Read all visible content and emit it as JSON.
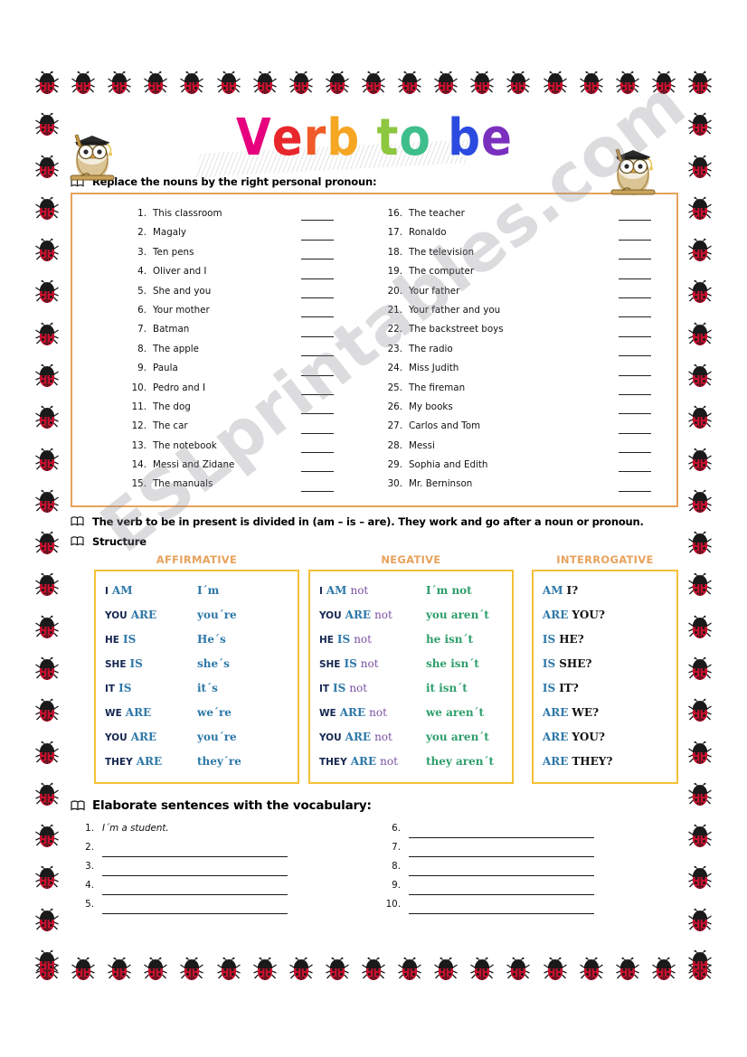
{
  "title": {
    "letters": [
      {
        "ch": "V",
        "color": "#E6007E"
      },
      {
        "ch": "e",
        "color": "#E8272C"
      },
      {
        "ch": "r",
        "color": "#F05A28"
      },
      {
        "ch": "b",
        "color": "#F5A623"
      },
      {
        "ch": " ",
        "color": "#ffffff"
      },
      {
        "ch": "t",
        "color": "#8DC63F"
      },
      {
        "ch": "o",
        "color": "#3DBE8B"
      },
      {
        "ch": " ",
        "color": "#ffffff"
      },
      {
        "ch": "b",
        "color": "#2B4BE0"
      },
      {
        "ch": "e",
        "color": "#7B2FBE"
      }
    ],
    "plain": "Verb to be"
  },
  "instructions": {
    "replace_nouns": "Replace the nouns by the right personal pronoun:",
    "verb_explain": "The verb to be in present is divided in (am – is – are). They work and go after a noun or pronoun.",
    "structure": "Structure",
    "elaborate": "Elaborate sentences with the vocabulary:"
  },
  "nouns_exercise": {
    "blank_placeholder": "",
    "column_left": [
      {
        "num": "1.",
        "text": "This classroom"
      },
      {
        "num": "2.",
        "text": "Magaly"
      },
      {
        "num": "3.",
        "text": "Ten pens"
      },
      {
        "num": "4.",
        "text": "Oliver and I"
      },
      {
        "num": "5.",
        "text": "She and you"
      },
      {
        "num": "6.",
        "text": "Your mother"
      },
      {
        "num": "7.",
        "text": "Batman"
      },
      {
        "num": "8.",
        "text": "The apple"
      },
      {
        "num": "9.",
        "text": "Paula"
      },
      {
        "num": "10.",
        "text": "Pedro and I"
      },
      {
        "num": "11.",
        "text": "The dog"
      },
      {
        "num": "12.",
        "text": "The car"
      },
      {
        "num": "13.",
        "text": "The notebook"
      },
      {
        "num": "14.",
        "text": "Messi and Zidane"
      },
      {
        "num": "15.",
        "text": "The manuals"
      }
    ],
    "column_right": [
      {
        "num": "16.",
        "text": "The teacher"
      },
      {
        "num": "17.",
        "text": "Ronaldo"
      },
      {
        "num": "18.",
        "text": "The television"
      },
      {
        "num": "19.",
        "text": "The computer"
      },
      {
        "num": "20.",
        "text": "Your father"
      },
      {
        "num": "21.",
        "text": "Your father and you"
      },
      {
        "num": "22.",
        "text": "The backstreet boys"
      },
      {
        "num": "23.",
        "text": "The radio"
      },
      {
        "num": "24.",
        "text": "Miss Judith"
      },
      {
        "num": "25.",
        "text": "The fireman"
      },
      {
        "num": "26.",
        "text": "My books"
      },
      {
        "num": "27.",
        "text": "Carlos and  Tom"
      },
      {
        "num": "28.",
        "text": "Messi"
      },
      {
        "num": "29.",
        "text": "Sophia and Edith"
      },
      {
        "num": "30.",
        "text": "Mr. Berninson"
      }
    ]
  },
  "structure_tables": {
    "affirmative": {
      "header": "AFFIRMATIVE",
      "rows": [
        {
          "pronoun": "I",
          "verb": "AM",
          "contraction": "I´m"
        },
        {
          "pronoun": "YOU",
          "verb": "ARE",
          "contraction": "you´re"
        },
        {
          "pronoun": "HE",
          "verb": "IS",
          "contraction": "He´s"
        },
        {
          "pronoun": "SHE",
          "verb": "IS",
          "contraction": "she´s"
        },
        {
          "pronoun": "IT",
          "verb": "IS",
          "contraction": "it´s"
        },
        {
          "pronoun": "WE",
          "verb": "ARE",
          "contraction": "we´re"
        },
        {
          "pronoun": "YOU",
          "verb": "ARE",
          "contraction": "you´re"
        },
        {
          "pronoun": "THEY",
          "verb": "ARE",
          "contraction": "they´re"
        }
      ]
    },
    "negative": {
      "header": "NEGATIVE",
      "not_word": "not",
      "rows": [
        {
          "pronoun": "I",
          "verb": "AM",
          "not": "not",
          "contraction": "I´m not"
        },
        {
          "pronoun": "YOU",
          "verb": "ARE",
          "not": "not",
          "contraction": "you aren´t"
        },
        {
          "pronoun": "HE",
          "verb": "IS",
          "not": "not",
          "contraction": "he isn´t"
        },
        {
          "pronoun": "SHE",
          "verb": "IS",
          "not": "not",
          "contraction": "she isn´t"
        },
        {
          "pronoun": "IT",
          "verb": "IS",
          "not": "not",
          "contraction": "it isn´t"
        },
        {
          "pronoun": "WE",
          "verb": "ARE",
          "not": "not",
          "contraction": "we aren´t"
        },
        {
          "pronoun": "YOU",
          "verb": "ARE",
          "not": "not",
          "contraction": "you aren´t"
        },
        {
          "pronoun": "THEY",
          "verb": "ARE",
          "not": "not",
          "contraction": "they aren´t"
        }
      ]
    },
    "interrogative": {
      "header": "INTERROGATIVE",
      "rows": [
        {
          "verb": "AM",
          "pronoun": "I?"
        },
        {
          "verb": "ARE",
          "pronoun": "YOU?"
        },
        {
          "verb": "IS",
          "pronoun": "HE?"
        },
        {
          "verb": "IS",
          "pronoun": "SHE?"
        },
        {
          "verb": "IS",
          "pronoun": "IT?"
        },
        {
          "verb": "ARE",
          "pronoun": "WE?"
        },
        {
          "verb": "ARE",
          "pronoun": "YOU?"
        },
        {
          "verb": "ARE",
          "pronoun": "THEY?"
        }
      ]
    }
  },
  "elaborate_exercise": {
    "column_left": [
      {
        "num": "1.",
        "answer": "I´m a student.",
        "blank": false
      },
      {
        "num": "2.",
        "answer": "",
        "blank": true
      },
      {
        "num": "3.",
        "answer": "",
        "blank": true
      },
      {
        "num": "4.",
        "answer": "",
        "blank": true
      },
      {
        "num": "5.",
        "answer": "",
        "blank": true
      }
    ],
    "column_right": [
      {
        "num": "6.",
        "answer": "",
        "blank": true
      },
      {
        "num": "7.",
        "answer": "",
        "blank": true
      },
      {
        "num": "8.",
        "answer": "",
        "blank": true
      },
      {
        "num": "9.",
        "answer": "",
        "blank": true
      },
      {
        "num": "10.",
        "answer": "",
        "blank": true
      }
    ]
  },
  "watermark": {
    "text": "ESLprintables.com"
  },
  "colors": {
    "box_border_orange": "#E8A25C",
    "table_border_yellow": "#F5C037",
    "header_orange": "#E8A25C",
    "pronoun_navy": "#152650",
    "verb_blue": "#2E78A8",
    "not_purple": "#7B4FA3",
    "contraction_green": "#2E9E6B",
    "ladybug_red": "#C8102E"
  },
  "decorations": {
    "border_icon": "ladybug-icon",
    "mascot_icon": "owl-graduate-icon",
    "bullet_icon": "open-book-icon"
  }
}
